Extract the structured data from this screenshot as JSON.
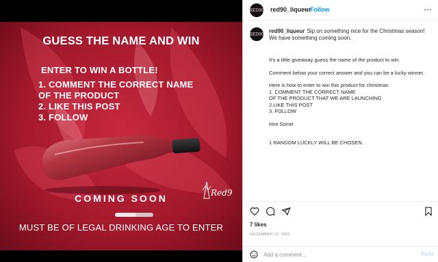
{
  "post_image": {
    "title": "GUESS THE NAME AND WIN",
    "subtitle": "ENTER TO WIN A BOTTLE!",
    "steps": [
      "1. COMMENT THE CORRECT NAME",
      "OF THE PRODUCT",
      "2. LIKE THIS POST",
      "3. FOLLOW"
    ],
    "coming_soon": "COMING SOON",
    "legal": "MUST BE OF LEGAL DRINKING AGE  TO ENTER",
    "carousel_progress": 0.55,
    "logo_text": "Red90"
  },
  "header": {
    "avatar_text": "RED90",
    "username": "red90_liqueur",
    "dot": "•",
    "follow_label": "Follow",
    "more_icon": "⋯"
  },
  "caption": {
    "username": "red90_liqueur",
    "intro": "Sip on something nice for the Christmas season! We have something coming soon.",
    "lines": [
      "It's a little giveaway guess the name of the product to win.",
      "",
      "Comment below your correct answer and you can be a lucky winner.",
      "",
      "Here is how to enter to win this product for christmas",
      "1. COMMENT THE CORRECT NAME",
      "OF THE PRODUCT THAT WE ARE LAUNCHING",
      "2.LIKE THIS POST",
      "3. FOLLOW",
      "",
      "Hint Sorrel",
      "",
      "",
      "1 RANDOM LUCKLY WILL BE CHOSEN."
    ]
  },
  "stats": {
    "likes": "7 likes",
    "date": "DECEMBER 12, 2022"
  },
  "comment": {
    "placeholder": "Add a comment...",
    "post_label": "Post"
  },
  "colors": {
    "background_red": "#a3182c",
    "follow_blue": "#0095f6"
  }
}
